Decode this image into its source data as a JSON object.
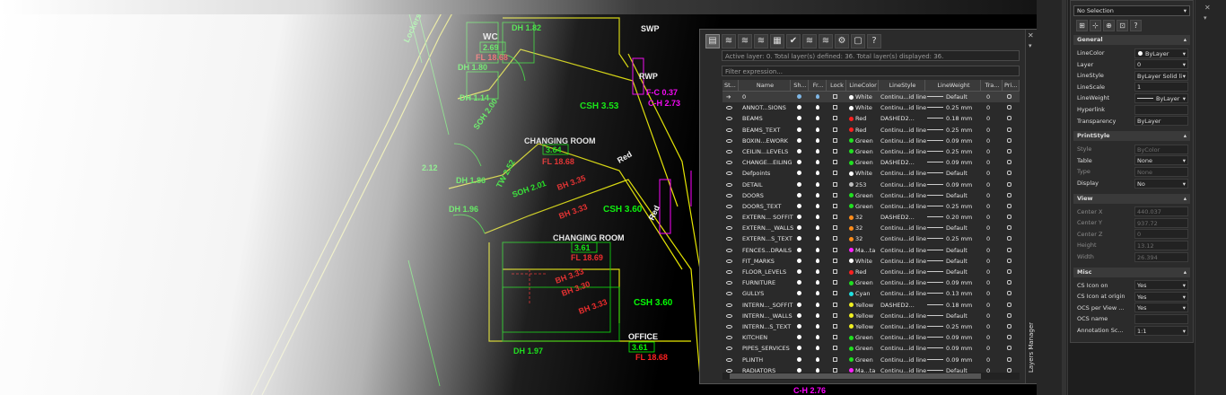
{
  "cad_labels": [
    {
      "t": "WC",
      "c": "#ffffff"
    },
    {
      "t": "2.69",
      "c": "#00ff00"
    },
    {
      "t": "FL 18.68",
      "c": "#ff2020"
    },
    {
      "t": "DH 1.82",
      "c": "#00ff00"
    },
    {
      "t": "DH 1.80",
      "c": "#00ff00"
    },
    {
      "t": "DH 1.14",
      "c": "#00ff00"
    },
    {
      "t": "SWP",
      "c": "#ffffff"
    },
    {
      "t": "RWP",
      "c": "#ffffff"
    },
    {
      "t": "F-C 0.37",
      "c": "#ff00ff"
    },
    {
      "t": "C-H 2.73",
      "c": "#ff00ff"
    },
    {
      "t": "CSH 3.53",
      "c": "#00ff00"
    },
    {
      "t": "CHANGING ROOM",
      "c": "#ffffff"
    },
    {
      "t": "3.64",
      "c": "#00ff00"
    },
    {
      "t": "FL 18.68",
      "c": "#ff2020"
    },
    {
      "t": "SOH 2.00",
      "c": "#00ff00"
    },
    {
      "t": "SOH 2.01",
      "c": "#00ff00"
    },
    {
      "t": "BH 3.35",
      "c": "#ff2020"
    },
    {
      "t": "BH 3.33",
      "c": "#ff2020"
    },
    {
      "t": "CSH 3.60",
      "c": "#00ff00"
    },
    {
      "t": "DH 1.86",
      "c": "#00ff00"
    },
    {
      "t": "DH 1.96",
      "c": "#00ff00"
    },
    {
      "t": "TW 2.52",
      "c": "#00ff00"
    },
    {
      "t": "2.12",
      "c": "#00ff00"
    },
    {
      "t": "Red",
      "c": "#ffffff"
    },
    {
      "t": "Red",
      "c": "#ffffff"
    },
    {
      "t": "CHANGING ROOM",
      "c": "#ffffff"
    },
    {
      "t": "3.61",
      "c": "#00ff00"
    },
    {
      "t": "FL 18.69",
      "c": "#ff2020"
    },
    {
      "t": "BH 3.33",
      "c": "#ff2020"
    },
    {
      "t": "BH 3.30",
      "c": "#ff2020"
    },
    {
      "t": "BH 3.33",
      "c": "#ff2020"
    },
    {
      "t": "CSH 3.60",
      "c": "#00ff00"
    },
    {
      "t": "OFFICE",
      "c": "#ffffff"
    },
    {
      "t": "3.61",
      "c": "#00ff00"
    },
    {
      "t": "FL 18.68",
      "c": "#ff2020"
    },
    {
      "t": "DH 1.97",
      "c": "#00ff00"
    },
    {
      "t": "Lockers",
      "c": "#00ff00"
    },
    {
      "t": "C-H 2.76",
      "c": "#ff00ff"
    }
  ],
  "layers_panel": {
    "title": "Layers Manager",
    "toolbar": [
      "layers-manager-icon",
      "new-layer-icon",
      "new-layer-vp-icon",
      "delete-layer-icon",
      "layer-states-icon",
      "set-current-icon",
      "layer-filter-icon",
      "layer-properties-icon",
      "settings-icon",
      "export-icon",
      "help-icon"
    ],
    "info": "Active layer: 0. Total layer(s) defined: 36. Total layer(s) displayed: 36.",
    "filter_placeholder": "Filter expression...",
    "columns": [
      "St...",
      "Name",
      "Sh...",
      "Fr...",
      "Lock",
      "LineColor",
      "LineStyle",
      "LineWeight",
      "Tra...",
      "Pri..."
    ],
    "rows": [
      {
        "name": "0",
        "color": "White",
        "swatch": "#ffffff",
        "style": "Continu...id line",
        "weight": "Default",
        "tra": "0",
        "current": true
      },
      {
        "name": "ANNOT...SIONS",
        "color": "White",
        "swatch": "#ffffff",
        "style": "Continu...id line",
        "weight": "0.25 mm",
        "tra": "0"
      },
      {
        "name": "BEAMS",
        "color": "Red",
        "swatch": "#ff2020",
        "style": "DASHED2...",
        "weight": "0.18 mm",
        "tra": "0"
      },
      {
        "name": "BEAMS_TEXT",
        "color": "Red",
        "swatch": "#ff2020",
        "style": "Continu...id line",
        "weight": "0.25 mm",
        "tra": "0"
      },
      {
        "name": "BOXIN...EWORK",
        "color": "Green",
        "swatch": "#20e020",
        "style": "Continu...id line",
        "weight": "0.09 mm",
        "tra": "0"
      },
      {
        "name": "CEILIN...LEVELS",
        "color": "Green",
        "swatch": "#20e020",
        "style": "Continu...id line",
        "weight": "0.25 mm",
        "tra": "0"
      },
      {
        "name": "CHANGE...EILING",
        "color": "Green",
        "swatch": "#20e020",
        "style": "DASHED2...",
        "weight": "0.09 mm",
        "tra": "0"
      },
      {
        "name": "Defpoints",
        "color": "White",
        "swatch": "#ffffff",
        "style": "Continu...id line",
        "weight": "Default",
        "tra": "0"
      },
      {
        "name": "DETAIL",
        "color": "253",
        "swatch": "#bdbdbd",
        "style": "Continu...id line",
        "weight": "0.09 mm",
        "tra": "0"
      },
      {
        "name": "DOORS",
        "color": "Green",
        "swatch": "#20e020",
        "style": "Continu...id line",
        "weight": "Default",
        "tra": "0"
      },
      {
        "name": "DOORS_TEXT",
        "color": "Green",
        "swatch": "#20e020",
        "style": "Continu...id line",
        "weight": "0.25 mm",
        "tra": "0"
      },
      {
        "name": "EXTERN... SOFFIT",
        "color": "32",
        "swatch": "#ff8c1a",
        "style": "DASHED2...",
        "weight": "0.20 mm",
        "tra": "0"
      },
      {
        "name": "EXTERN..._WALLS",
        "color": "32",
        "swatch": "#ff8c1a",
        "style": "Continu...id line",
        "weight": "Default",
        "tra": "0"
      },
      {
        "name": "EXTERN...S_TEXT",
        "color": "32",
        "swatch": "#ff8c1a",
        "style": "Continu...id line",
        "weight": "0.25 mm",
        "tra": "0"
      },
      {
        "name": "FENCES...DRAILS",
        "color": "Ma...ta",
        "swatch": "#ff20ff",
        "style": "Continu...id line",
        "weight": "Default",
        "tra": "0"
      },
      {
        "name": "FIT_MARKS",
        "color": "White",
        "swatch": "#ffffff",
        "style": "Continu...id line",
        "weight": "Default",
        "tra": "0"
      },
      {
        "name": "FLOOR_LEVELS",
        "color": "Red",
        "swatch": "#ff2020",
        "style": "Continu...id line",
        "weight": "Default",
        "tra": "0"
      },
      {
        "name": "FURNITURE",
        "color": "Green",
        "swatch": "#20e020",
        "style": "Continu...id line",
        "weight": "0.09 mm",
        "tra": "0"
      },
      {
        "name": "GULLYS",
        "color": "Cyan",
        "swatch": "#20e0e0",
        "style": "Continu...id line",
        "weight": "0.13 mm",
        "tra": "0"
      },
      {
        "name": "INTERN..._SOFFIT",
        "color": "Yellow",
        "swatch": "#f0f020",
        "style": "DASHED2...",
        "weight": "0.18 mm",
        "tra": "0"
      },
      {
        "name": "INTERN..._WALLS",
        "color": "Yellow",
        "swatch": "#f0f020",
        "style": "Continu...id line",
        "weight": "Default",
        "tra": "0"
      },
      {
        "name": "INTERN...S_TEXT",
        "color": "Yellow",
        "swatch": "#f0f020",
        "style": "Continu...id line",
        "weight": "0.25 mm",
        "tra": "0"
      },
      {
        "name": "KITCHEN",
        "color": "Green",
        "swatch": "#20e020",
        "style": "Continu...id line",
        "weight": "0.09 mm",
        "tra": "0"
      },
      {
        "name": "PIPES_SERVICES",
        "color": "Green",
        "swatch": "#20e020",
        "style": "Continu...id line",
        "weight": "0.09 mm",
        "tra": "0"
      },
      {
        "name": "PLINTH",
        "color": "Green",
        "swatch": "#20e020",
        "style": "Continu...id line",
        "weight": "0.09 mm",
        "tra": "0"
      },
      {
        "name": "RADIATORS",
        "color": "Ma...ta",
        "swatch": "#ff20ff",
        "style": "Continu...id line",
        "weight": "Default",
        "tra": "0"
      }
    ]
  },
  "properties": {
    "selection": "No Selection",
    "toolbar": [
      "select-objects-icon",
      "quick-select-icon",
      "toggle-pickadd-icon",
      "select-similar-icon",
      "help-icon"
    ],
    "sections": [
      {
        "title": "General",
        "rows": [
          {
            "label": "LineColor",
            "value": "ByLayer",
            "swatch": "#ffffff",
            "dropdown": true
          },
          {
            "label": "Layer",
            "value": "0",
            "dropdown": true
          },
          {
            "label": "LineStyle",
            "value": "ByLayer      Solid li",
            "dropdown": true
          },
          {
            "label": "LineScale",
            "value": "1"
          },
          {
            "label": "LineWeight",
            "value": "ByLayer",
            "lw": true,
            "dropdown": true
          },
          {
            "label": "Hyperlink",
            "value": ""
          },
          {
            "label": "Transparency",
            "value": "ByLayer"
          }
        ]
      },
      {
        "title": "PrintStyle",
        "rows": [
          {
            "label": "Style",
            "value": "ByColor",
            "disabled": true
          },
          {
            "label": "Table",
            "value": "None",
            "dropdown": true
          },
          {
            "label": "Type",
            "value": "None",
            "disabled": true
          },
          {
            "label": "Display",
            "value": "No",
            "dropdown": true
          }
        ]
      },
      {
        "title": "View",
        "rows": [
          {
            "label": "Center X",
            "value": "440.037",
            "disabled": true
          },
          {
            "label": "Center Y",
            "value": "937.72",
            "disabled": true
          },
          {
            "label": "Center Z",
            "value": "0",
            "disabled": true
          },
          {
            "label": "Height",
            "value": "13.12",
            "disabled": true
          },
          {
            "label": "Width",
            "value": "26.394",
            "disabled": true
          }
        ]
      },
      {
        "title": "Misc",
        "rows": [
          {
            "label": "CS Icon on",
            "value": "Yes",
            "dropdown": true
          },
          {
            "label": "CS Icon at origin",
            "value": "Yes",
            "dropdown": true
          },
          {
            "label": "OCS per View ...",
            "value": "Yes",
            "dropdown": true
          },
          {
            "label": "OCS name",
            "value": ""
          },
          {
            "label": "Annotation Sc...",
            "value": "1:1",
            "dropdown": true
          }
        ]
      }
    ]
  }
}
